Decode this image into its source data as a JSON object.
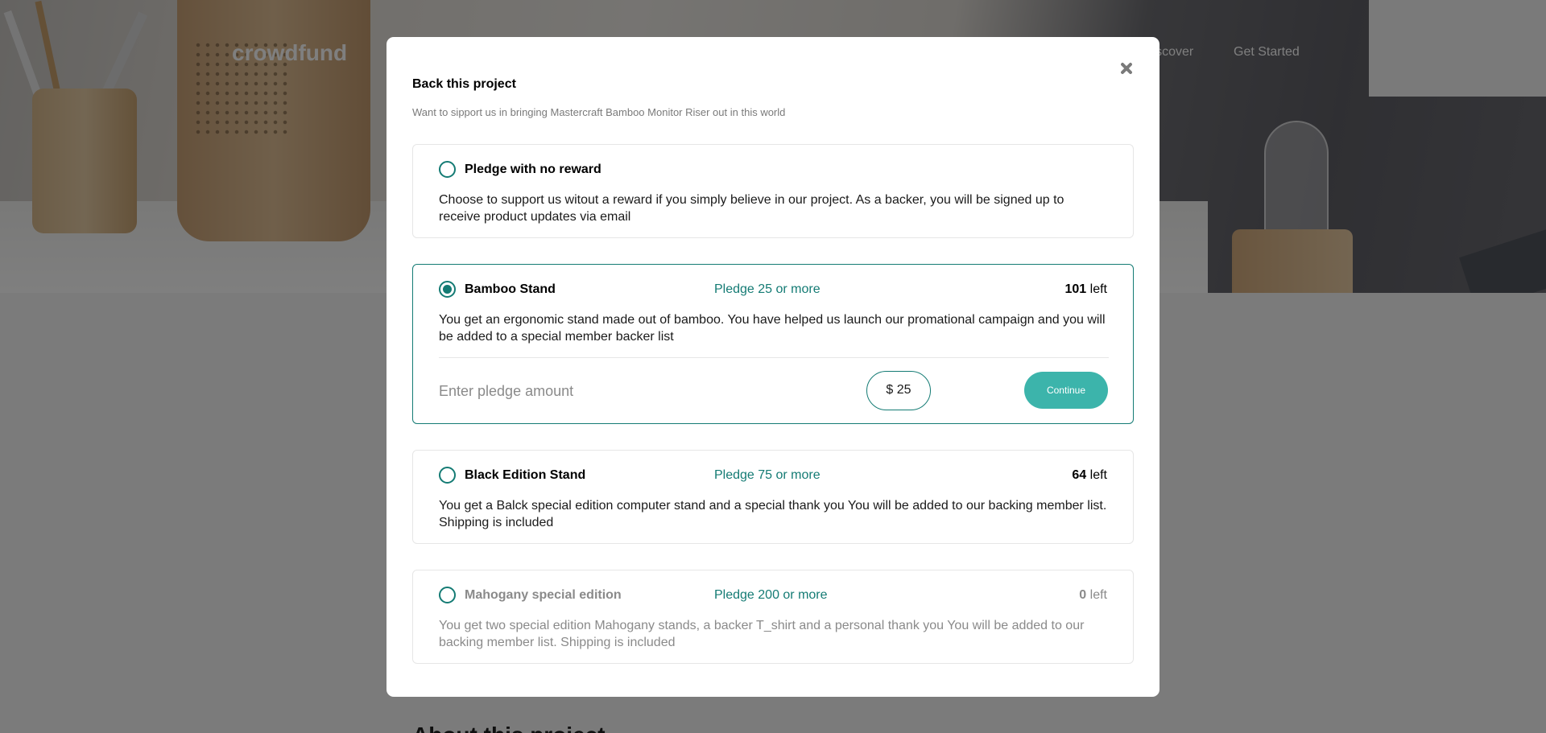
{
  "header": {
    "brand": "crowdfund",
    "nav": [
      {
        "label": "Discover"
      },
      {
        "label": "Get Started"
      }
    ]
  },
  "page": {
    "behind_heading": "About this project"
  },
  "modal": {
    "title": "Back this project",
    "subtitle": "Want to sipport us in bringing Mastercraft Bamboo Monitor Riser out in this world",
    "options": [
      {
        "title": "Pledge with no reward",
        "description": "Choose to support us witout a reward if you simply believe in our project. As a backer, you will be signed up to receive product updates via email",
        "selected": false
      },
      {
        "title": "Bamboo Stand",
        "pledge": "Pledge 25 or more",
        "left_count": "101",
        "left_label": "left",
        "description": "You get an ergonomic stand made out of bamboo. You have helped us launch our promational campaign and you will be added to a special member backer list",
        "selected": true,
        "enter_label": "Enter pledge amount",
        "amount": "$ 25",
        "continue_label": "Continue"
      },
      {
        "title": "Black Edition Stand",
        "pledge": "Pledge 75 or more",
        "left_count": "64",
        "left_label": "left",
        "description": "You get a Balck special edition computer stand and a special thank you You will be added to our backing member list. Shipping is included",
        "selected": false
      },
      {
        "title": "Mahogany special edition",
        "pledge": "Pledge 200 or more",
        "left_count": "0",
        "left_label": "left",
        "description": "You get two special edition Mahogany stands, a backer T_shirt and a personal thank you You will be added to our backing member list. Shipping is included",
        "selected": false,
        "disabled": true
      }
    ]
  },
  "colors": {
    "accent": "#147b74",
    "button": "#3cb4ab"
  }
}
